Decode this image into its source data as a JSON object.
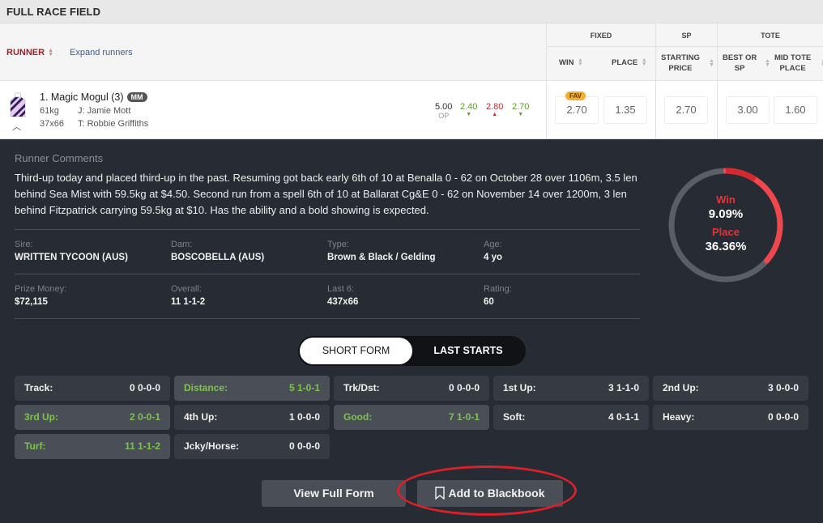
{
  "header": {
    "title": "FULL RACE FIELD",
    "runner_label": "RUNNER",
    "expand_label": "Expand runners",
    "groups": {
      "fixed": "FIXED",
      "sp": "SP",
      "tote": "TOTE"
    },
    "columns": {
      "win": "WIN",
      "place": "PLACE",
      "starting_price_1": "STARTING",
      "starting_price_2": "PRICE",
      "best_or_sp_1": "BEST OR",
      "best_or_sp_2": "SP",
      "mid_tote_place_1": "MID TOTE",
      "mid_tote_place_2": "PLACE"
    }
  },
  "runner": {
    "name": "1. Magic Mogul (3)",
    "badge": "MM",
    "weight": "61kg",
    "jockey": "J: Jamie Mott",
    "form": "37x66",
    "trainer": "T: Robbie Griffiths",
    "flucs": [
      {
        "value": "5.00",
        "sub": "OP",
        "color": "#333333",
        "dir": ""
      },
      {
        "value": "2.40",
        "sub": "▼",
        "color": "#5aa02c",
        "dir": "down"
      },
      {
        "value": "2.80",
        "sub": "▲",
        "color": "#c0303a",
        "dir": "up"
      },
      {
        "value": "2.70",
        "sub": "▼",
        "color": "#5aa02c",
        "dir": "down"
      }
    ],
    "fav_badge": "FAV",
    "odds": {
      "fixed_win": "2.70",
      "fixed_place": "1.35",
      "starting_price": "2.70",
      "best_or_sp": "3.00",
      "mid_tote_place": "1.60"
    }
  },
  "comments": {
    "title": "Runner Comments",
    "text": "Third-up today and placed third-up in the past. Resuming got back early 6th of 10 at Benalla 0 - 62 on October 28 over 1106m, 3.5 len behind Sea Mist with 59.5kg at $4.50. Second run from a spell 6th of 10 at Ballarat Cg&E 0 - 62 on November 14 over 1200m, 3 len behind Fitzpatrick carrying 59.5kg at $10. Has the ability and a bold showing is expected."
  },
  "info": {
    "sire_label": "Sire:",
    "sire": "WRITTEN TYCOON (AUS)",
    "dam_label": "Dam:",
    "dam": "BOSCOBELLA (AUS)",
    "type_label": "Type:",
    "type": "Brown & Black / Gelding",
    "age_label": "Age:",
    "age": "4 yo",
    "prize_label": "Prize Money:",
    "prize": "$72,115",
    "overall_label": "Overall:",
    "overall": "11 1-1-2",
    "last6_label": "Last 6:",
    "last6": "437x66",
    "rating_label": "Rating:",
    "rating": "60"
  },
  "probability": {
    "win_label": "Win",
    "win": "9.09%",
    "win_fraction": 0.0909,
    "place_label": "Place",
    "place": "36.36%",
    "place_fraction": 0.3636,
    "colors": {
      "track": "#5a5e66",
      "win": "#d42a2f",
      "place": "#f0474d",
      "label": "#e2343b"
    }
  },
  "tabs": {
    "short_form": "SHORT FORM",
    "last_starts": "LAST STARTS",
    "active": "short_form"
  },
  "stats": [
    {
      "label": "Track:",
      "value": "0 0-0-0",
      "highlight": false
    },
    {
      "label": "Distance:",
      "value": "5 1-0-1",
      "highlight": true
    },
    {
      "label": "Trk/Dst:",
      "value": "0 0-0-0",
      "highlight": false
    },
    {
      "label": "1st Up:",
      "value": "3 1-1-0",
      "highlight": false
    },
    {
      "label": "2nd Up:",
      "value": "3 0-0-0",
      "highlight": false
    },
    {
      "label": "3rd Up:",
      "value": "2 0-0-1",
      "highlight": true
    },
    {
      "label": "4th Up:",
      "value": "1 0-0-0",
      "highlight": false
    },
    {
      "label": "Good:",
      "value": "7 1-0-1",
      "highlight": true
    },
    {
      "label": "Soft:",
      "value": "4 0-1-1",
      "highlight": false
    },
    {
      "label": "Heavy:",
      "value": "0 0-0-0",
      "highlight": false
    },
    {
      "label": "Turf:",
      "value": "11 1-1-2",
      "highlight": true
    },
    {
      "label": "Jcky/Horse:",
      "value": "0 0-0-0",
      "highlight": false
    }
  ],
  "buttons": {
    "view_full_form": "View Full Form",
    "add_to_blackbook": "Add to Blackbook"
  }
}
